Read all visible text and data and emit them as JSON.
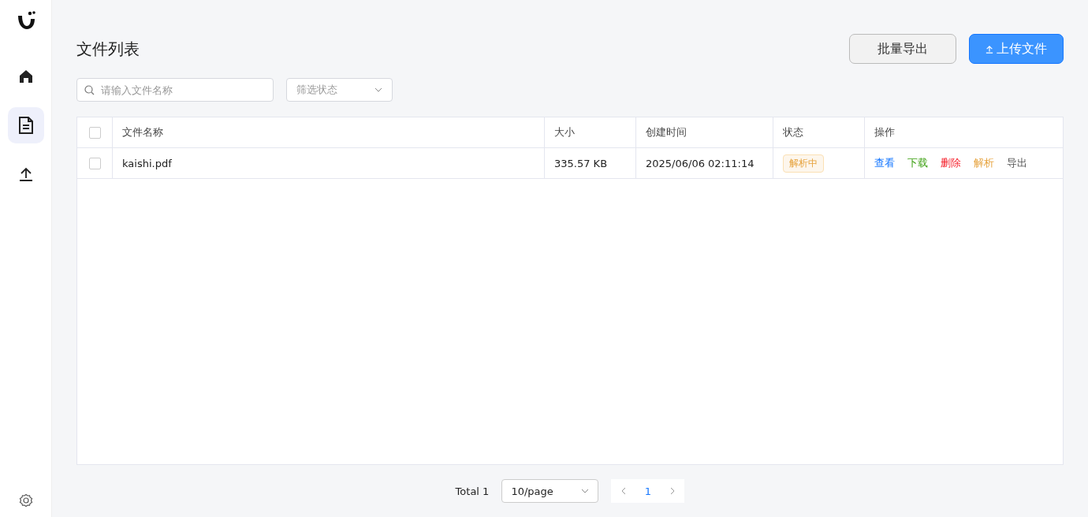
{
  "sidebar": {
    "items": [
      {
        "kind": "home",
        "selected": false
      },
      {
        "kind": "document",
        "selected": true
      },
      {
        "kind": "upload",
        "selected": false
      }
    ]
  },
  "page": {
    "title": "文件列表"
  },
  "toolbar": {
    "buttons": [
      {
        "label": "批量导出",
        "kind": "default"
      },
      {
        "label": "上传文件",
        "kind": "primary"
      }
    ]
  },
  "search": {
    "placeholder": "请输入文件名称"
  },
  "status_filter": {
    "placeholder": "筛选状态"
  },
  "table": {
    "columns": [
      "文件名称",
      "大小",
      "创建时间",
      "状态",
      "操作"
    ],
    "header_checked": false,
    "rows": [
      {
        "checked": false,
        "name": "kaishi.pdf",
        "size": "335.57 KB",
        "created": "2025/06/06 02:11:14",
        "status": "解析中",
        "actions": [
          {
            "label": "查看",
            "kind": "view"
          },
          {
            "label": "下载",
            "kind": "download"
          },
          {
            "label": "删除",
            "kind": "delete"
          },
          {
            "label": "解析",
            "kind": "parse"
          },
          {
            "label": "导出",
            "kind": "export"
          }
        ]
      }
    ]
  },
  "pagination": {
    "total": "Total 1",
    "page_size": "10/page",
    "pages": [
      {
        "label": "1",
        "selected": true
      }
    ]
  }
}
